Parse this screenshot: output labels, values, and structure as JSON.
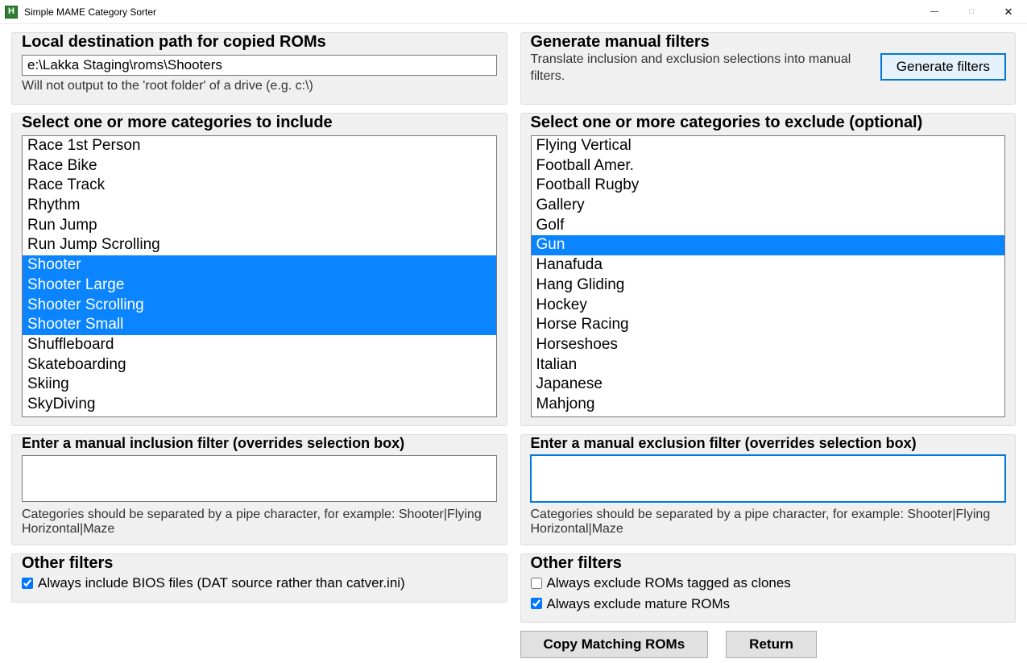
{
  "window": {
    "title": "Simple MAME Category Sorter"
  },
  "left": {
    "dest": {
      "heading": "Local destination path for copied ROMs",
      "value": "e:\\Lakka Staging\\roms\\Shooters",
      "helper": "Will not output to the 'root folder' of a drive (e.g. c:\\)"
    },
    "include": {
      "heading": "Select one or more categories to include",
      "items": [
        {
          "label": "Race 1st Person",
          "selected": false
        },
        {
          "label": "Race Bike",
          "selected": false
        },
        {
          "label": "Race Track",
          "selected": false
        },
        {
          "label": "Rhythm",
          "selected": false
        },
        {
          "label": "Run Jump",
          "selected": false
        },
        {
          "label": "Run Jump Scrolling",
          "selected": false
        },
        {
          "label": "Shooter",
          "selected": true
        },
        {
          "label": "Shooter Large",
          "selected": true
        },
        {
          "label": "Shooter Scrolling",
          "selected": true
        },
        {
          "label": "Shooter Small",
          "selected": true
        },
        {
          "label": "Shuffleboard",
          "selected": false
        },
        {
          "label": "Skateboarding",
          "selected": false
        },
        {
          "label": "Skiing",
          "selected": false
        },
        {
          "label": "SkyDiving",
          "selected": false
        }
      ]
    },
    "manual_filter": {
      "heading": "Enter a manual inclusion filter (overrides selection box)",
      "value": "",
      "helper": "Categories should be separated by a pipe character, for example: Shooter|Flying Horizontal|Maze"
    },
    "other": {
      "heading": "Other filters",
      "bios": {
        "label": "Always include BIOS files (DAT source rather than catver.ini)",
        "checked": true
      }
    }
  },
  "right": {
    "gen": {
      "heading": "Generate manual filters",
      "sub": "Translate inclusion and exclusion selections into manual filters.",
      "button": "Generate filters"
    },
    "exclude": {
      "heading": "Select one or more categories to exclude (optional)",
      "items": [
        {
          "label": "Flying Vertical",
          "selected": false
        },
        {
          "label": "Football Amer.",
          "selected": false
        },
        {
          "label": "Football Rugby",
          "selected": false
        },
        {
          "label": "Gallery",
          "selected": false
        },
        {
          "label": "Golf",
          "selected": false
        },
        {
          "label": "Gun",
          "selected": true
        },
        {
          "label": "Hanafuda",
          "selected": false
        },
        {
          "label": "Hang Gliding",
          "selected": false
        },
        {
          "label": "Hockey",
          "selected": false
        },
        {
          "label": "Horse Racing",
          "selected": false
        },
        {
          "label": "Horseshoes",
          "selected": false
        },
        {
          "label": "Italian",
          "selected": false
        },
        {
          "label": "Japanese",
          "selected": false
        },
        {
          "label": "Mahjong",
          "selected": false
        }
      ]
    },
    "manual_filter": {
      "heading": "Enter a manual exclusion filter (overrides selection box)",
      "value": "",
      "helper": "Categories should be separated by a pipe character, for example: Shooter|Flying Horizontal|Maze"
    },
    "other": {
      "heading": "Other filters",
      "clones": {
        "label": "Always exclude ROMs tagged as clones",
        "checked": false
      },
      "mature": {
        "label": "Always exclude mature ROMs",
        "checked": true
      }
    }
  },
  "actions": {
    "copy": "Copy Matching ROMs",
    "return": "Return"
  }
}
